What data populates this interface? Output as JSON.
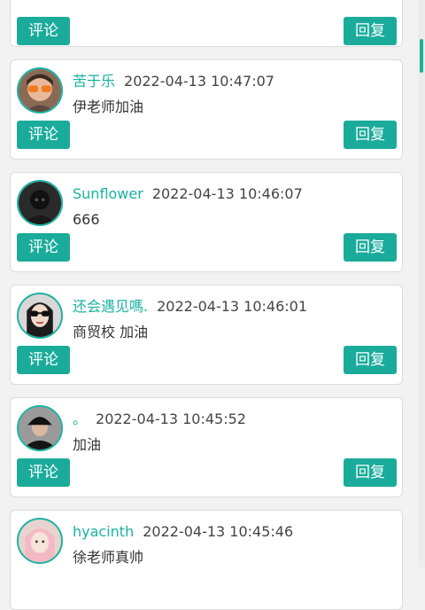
{
  "buttons": {
    "comment_label": "评论",
    "reply_label": "回复"
  },
  "comments": [
    {
      "name": "",
      "time": "",
      "content": "",
      "avatar": "none"
    },
    {
      "name": "苦于乐",
      "time": "2022-04-13 10:47:07",
      "content": "伊老师加油",
      "avatar": "avatar-orange-sunglasses"
    },
    {
      "name": "Sunflower",
      "time": "2022-04-13 10:46:07",
      "content": "666",
      "avatar": "avatar-dark-figure"
    },
    {
      "name": "还会遇见嗎.",
      "time": "2022-04-13 10:46:01",
      "content": "商贸校 加油",
      "avatar": "avatar-woman-sunglasses"
    },
    {
      "name": "。",
      "time": "2022-04-13 10:45:52",
      "content": "加油",
      "avatar": "avatar-black-cap"
    },
    {
      "name": "hyacinth",
      "time": "2022-04-13 10:45:46",
      "content": "徐老师真帅",
      "avatar": "avatar-pink-girl"
    }
  ],
  "colors": {
    "accent": "#19b2a0",
    "button": "#1aab9b",
    "background": "#f2f2f2",
    "card": "#ffffff"
  },
  "scrollbar": {
    "position": 0.07
  }
}
